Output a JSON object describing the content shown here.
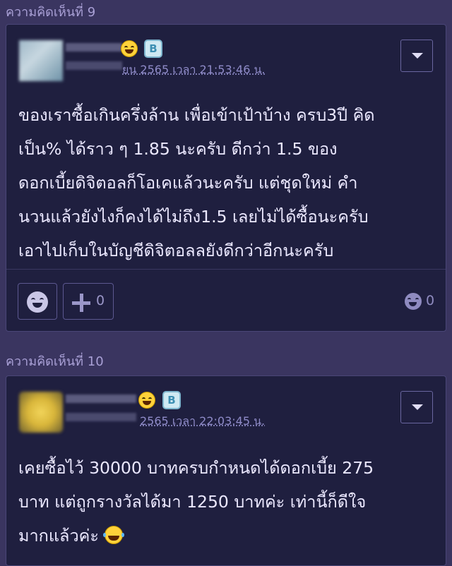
{
  "comments": [
    {
      "label": "ความคิดเห็นที่ 9",
      "timestamp": "ยน 2565 เวลา 21:53:46 น.",
      "badge_letter": "B",
      "text": "ของเราซื้อเกินครึ่งล้าน เพื่อเข้าเป้าบ้าง ครบ3ปี คิด\nเป็น% ได้ราว ๆ 1.85 นะครับ ดีกว่า 1.5 ของ\nดอกเบี้ยดิจิตอลก็โอเคแล้วนะครับ แต่ชุดใหม่ คำ\nนวนแล้วยังไงก็คงได้ไม่ถึง1.5 เลยไม่ได้ซื้อนะครับ\nเอาไปเก็บในบัญชีดิจิตอลลยังดีกว่าอีกนะครับ",
      "plus_count": "0",
      "reaction_count": "0",
      "avatar_colors": [
        "#9fb8c8",
        "#6f93a8"
      ],
      "accent_color": "#ffd23a"
    },
    {
      "label": "ความคิดเห็นที่ 10",
      "timestamp": "2565 เวลา 22:03:45 น.",
      "badge_letter": "B",
      "text": "เคยซื้อไว้ 30000 บาทครบกำหนดได้ดอกเบี้ย 275\nบาท แต่ถูกรางวัลได้มา 1250 บาทค่ะ เท่านี้ก็ดีใจ\nมากแล้วค่ะ",
      "avatar_colors": [
        "#e3c24a",
        "#8a7a30"
      ]
    }
  ],
  "icons": {
    "laugh": "laughing-emoji-icon",
    "badge": "blog-badge-icon",
    "menu": "chevron-down-icon",
    "smile": "smile-icon",
    "plus": "plus-icon"
  }
}
